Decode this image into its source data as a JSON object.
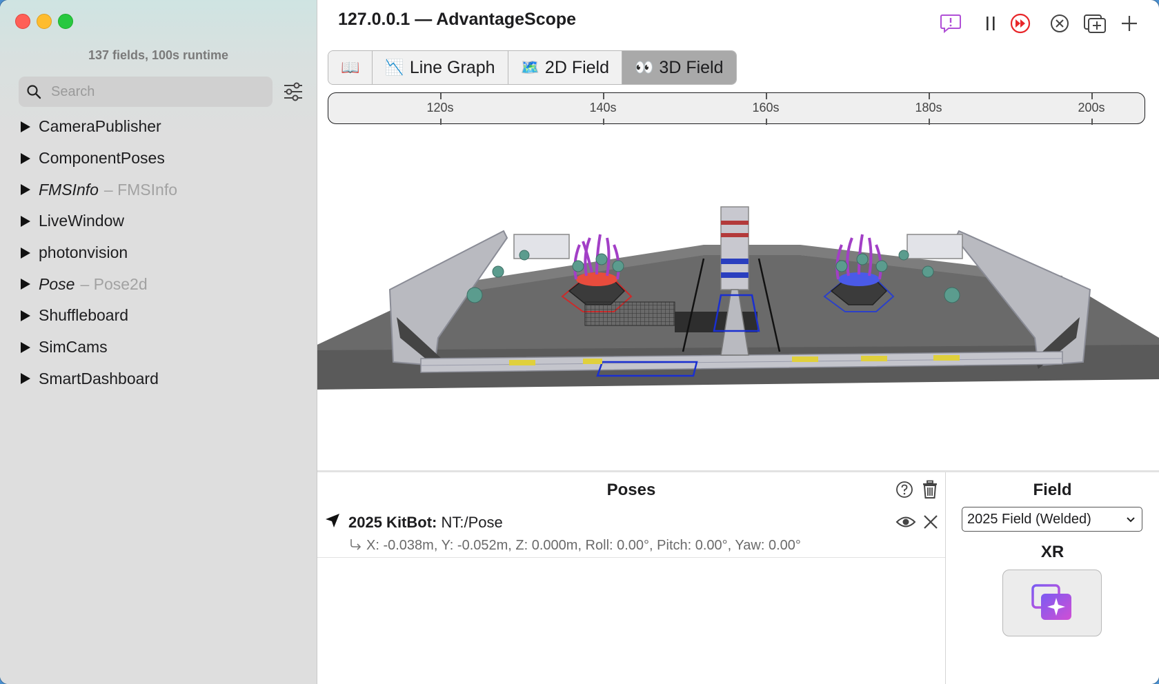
{
  "window": {
    "title": "127.0.0.1 — AdvantageScope"
  },
  "sidebar": {
    "summary": "137 fields, 100s runtime",
    "search_placeholder": "Search",
    "items": [
      {
        "label": "CameraPublisher",
        "type": "",
        "italic": false
      },
      {
        "label": "ComponentPoses",
        "type": "",
        "italic": false
      },
      {
        "label": "FMSInfo",
        "type": "– FMSInfo",
        "italic": true
      },
      {
        "label": "LiveWindow",
        "type": "",
        "italic": false
      },
      {
        "label": "photonvision",
        "type": "",
        "italic": false
      },
      {
        "label": "Pose",
        "type": "– Pose2d",
        "italic": true
      },
      {
        "label": "Shuffleboard",
        "type": "",
        "italic": false
      },
      {
        "label": "SimCams",
        "type": "",
        "italic": false
      },
      {
        "label": "SmartDashboard",
        "type": "",
        "italic": false
      }
    ]
  },
  "toolbar": {
    "icons": [
      "feedback-icon",
      "pause-icon",
      "live-icon",
      "close-circle-icon",
      "add-window-icon",
      "plus-icon"
    ],
    "live_color": "#e8262a",
    "feedback_color": "#b04fd6"
  },
  "tabs": [
    {
      "emoji": "📖",
      "label": ""
    },
    {
      "emoji": "📉",
      "label": "Line Graph"
    },
    {
      "emoji": "🗺️",
      "label": "2D Field"
    },
    {
      "emoji": "👀",
      "label": "3D Field"
    }
  ],
  "timeline": {
    "ticks": [
      "120s",
      "140s",
      "160s",
      "180s",
      "200s"
    ]
  },
  "poses_panel": {
    "title": "Poses",
    "pose_name": "2025 KitBot:",
    "pose_source": "NT:/Pose",
    "pose_values": "X: -0.038m, Y: -0.052m, Z: 0.000m, Roll: 0.00°, Pitch: 0.00°, Yaw: 0.00°"
  },
  "field_panel": {
    "title": "Field",
    "selected_field": "2025 Field (Welded)",
    "xr_title": "XR"
  }
}
